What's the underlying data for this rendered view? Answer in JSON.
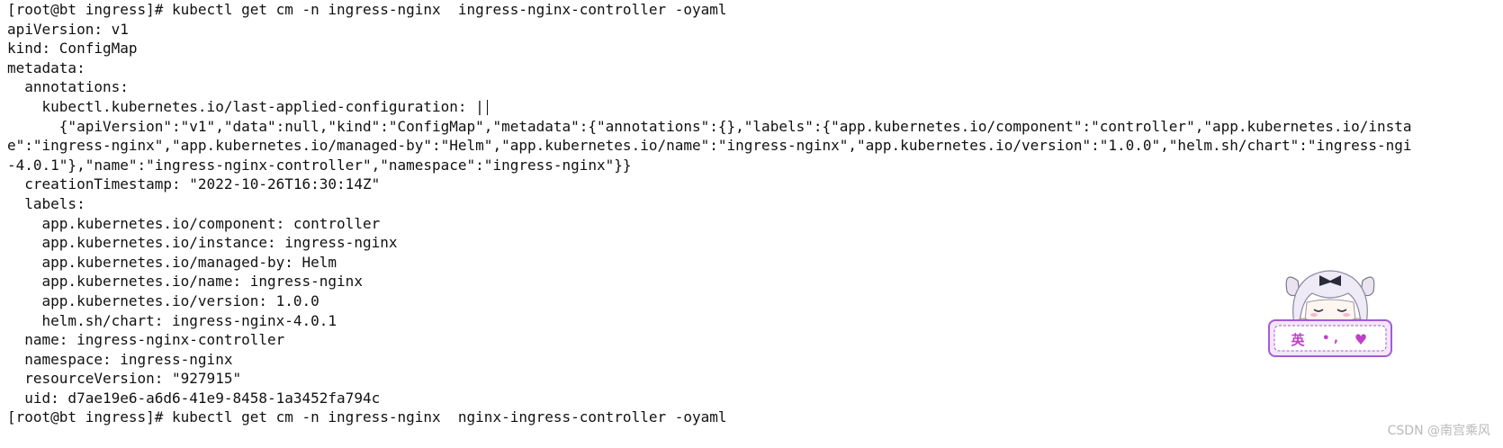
{
  "terminal": {
    "lines": [
      "[root@bt ingress]# kubectl get cm -n ingress-nginx  ingress-nginx-controller -oyaml",
      "apiVersion: v1",
      "kind: ConfigMap",
      "metadata:",
      "  annotations:",
      "    kubectl.kubernetes.io/last-applied-configuration: |",
      "      {\"apiVersion\":\"v1\",\"data\":null,\"kind\":\"ConfigMap\",\"metadata\":{\"annotations\":{},\"labels\":{\"app.kubernetes.io/component\":\"controller\",\"app.kubernetes.io/instanc",
      "e\":\"ingress-nginx\",\"app.kubernetes.io/managed-by\":\"Helm\",\"app.kubernetes.io/name\":\"ingress-nginx\",\"app.kubernetes.io/version\":\"1.0.0\",\"helm.sh/chart\":\"ingress-nginx",
      "-4.0.1\"},\"name\":\"ingress-nginx-controller\",\"namespace\":\"ingress-nginx\"}}",
      "  creationTimestamp: \"2022-10-26T16:30:14Z\"",
      "  labels:",
      "    app.kubernetes.io/component: controller",
      "    app.kubernetes.io/instance: ingress-nginx",
      "    app.kubernetes.io/managed-by: Helm",
      "    app.kubernetes.io/name: ingress-nginx",
      "    app.kubernetes.io/version: 1.0.0",
      "    helm.sh/chart: ingress-nginx-4.0.1",
      "  name: ingress-nginx-controller",
      "  namespace: ingress-nginx",
      "  resourceVersion: \"927915\"",
      "  uid: d7ae19e6-a6d6-41e9-8458-1a3452fa794c",
      "[root@bt ingress]# kubectl get cm -n ingress-nginx  nginx-ingress-controller -oyaml"
    ]
  },
  "sticker": {
    "glyph_left": "英",
    "glyph_mid": "• ,",
    "glyph_right": "♥"
  },
  "watermark": "CSDN @南宫乘风",
  "colors": {
    "text": "#111111",
    "sticker_border": "#a45bd6",
    "sticker_text": "#c040c8",
    "watermark": "#b9b9b9"
  }
}
